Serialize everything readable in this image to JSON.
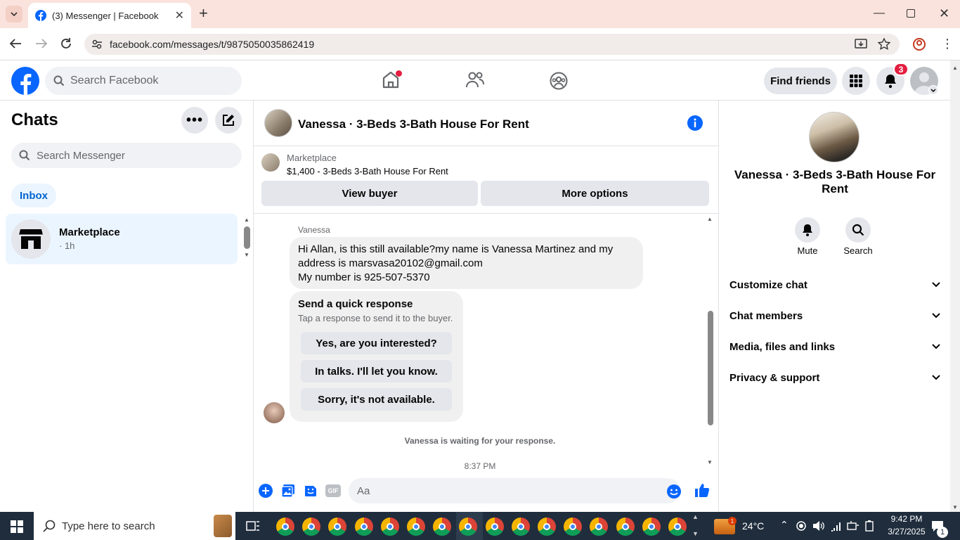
{
  "browser": {
    "tab_title": "(3) Messenger | Facebook",
    "url": "facebook.com/messages/t/9875050035862419",
    "accent": "#fbe3dd"
  },
  "fbnav": {
    "search_placeholder": "Search Facebook",
    "find_friends": "Find friends",
    "notification_count": "3",
    "brand_color": "#0866ff"
  },
  "sidebar": {
    "title": "Chats",
    "search_placeholder": "Search Messenger",
    "filter": "Inbox",
    "chats": [
      {
        "name": "Marketplace",
        "time": "· 1h"
      }
    ]
  },
  "conversation": {
    "title": "Vanessa · 3-Beds 3-Bath House For Rent",
    "listing_label": "Marketplace",
    "listing_detail": "$1,400 - 3-Beds 3-Bath House For Rent",
    "view_buyer": "View buyer",
    "more_options": "More options",
    "sender": "Vanessa",
    "message_lines": [
      "Hi Allan, is this still available?my name is Vanessa Martinez and my",
      "address is marsvasa20102@gmail.com",
      "My number is 925-507-5370"
    ],
    "quick_title": "Send a quick response",
    "quick_subtitle": "Tap a response to send it to the buyer.",
    "quick_responses": [
      "Yes, are you interested?",
      "In talks. I'll let you know.",
      "Sorry, it's not available."
    ],
    "waiting": "Vanessa is waiting for your response.",
    "timestamp": "8:37 PM",
    "composer_placeholder": "Aa"
  },
  "details": {
    "title": "Vanessa · 3-Beds 3-Bath House For Rent",
    "mute": "Mute",
    "search": "Search",
    "sections": [
      "Customize chat",
      "Chat members",
      "Media, files and links",
      "Privacy & support"
    ]
  },
  "taskbar": {
    "search_placeholder": "Type here to search",
    "temperature": "24°C",
    "time": "9:42 PM",
    "date": "3/27/2025",
    "notif_count": "1"
  }
}
